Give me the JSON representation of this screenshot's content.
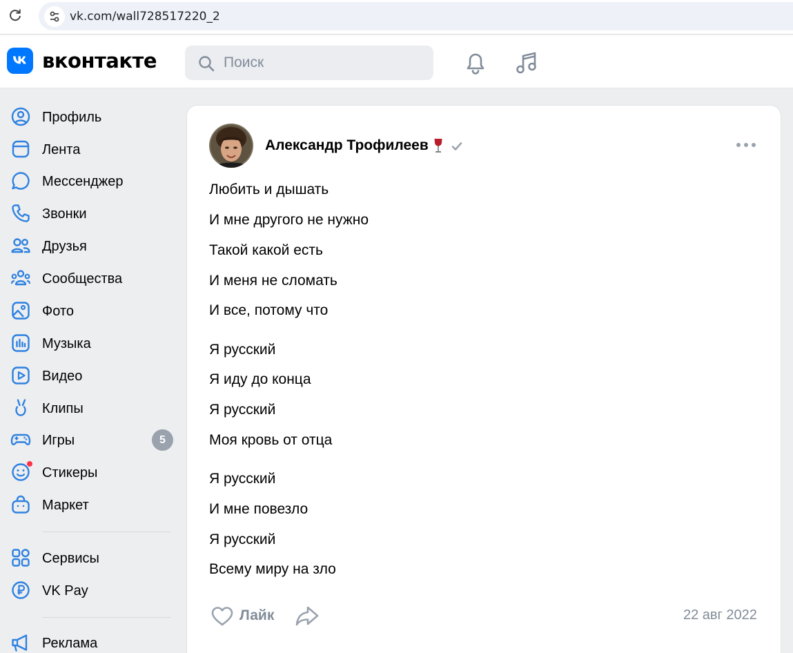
{
  "browser": {
    "url": "vk.com/wall728517220_2"
  },
  "header": {
    "brand": "вконтакте",
    "search_placeholder": "Поиск"
  },
  "sidebar": {
    "items": [
      {
        "label": "Профиль",
        "icon": "profile-icon"
      },
      {
        "label": "Лента",
        "icon": "feed-icon"
      },
      {
        "label": "Мессенджер",
        "icon": "messenger-icon"
      },
      {
        "label": "Звонки",
        "icon": "phone-icon"
      },
      {
        "label": "Друзья",
        "icon": "friends-icon"
      },
      {
        "label": "Сообщества",
        "icon": "communities-icon"
      },
      {
        "label": "Фото",
        "icon": "photo-icon"
      },
      {
        "label": "Музыка",
        "icon": "music-icon"
      },
      {
        "label": "Видео",
        "icon": "video-icon"
      },
      {
        "label": "Клипы",
        "icon": "clips-icon"
      },
      {
        "label": "Игры",
        "icon": "games-icon",
        "badge": "5"
      },
      {
        "label": "Стикеры",
        "icon": "stickers-icon"
      },
      {
        "label": "Маркет",
        "icon": "market-icon"
      },
      {
        "label": "Сервисы",
        "icon": "services-icon"
      },
      {
        "label": "VK Pay",
        "icon": "vkpay-icon"
      },
      {
        "label": "Реклама",
        "icon": "ads-icon"
      }
    ]
  },
  "post": {
    "author": "Александр Трофилеев",
    "emoji": "🍷",
    "lines": [
      "Любить и дышать",
      "И мне другого не нужно",
      "Такой какой есть",
      "И меня не сломать",
      "И все, потому что",
      "Я русский",
      "Я иду до конца",
      "Я русский",
      "Моя кровь от отца",
      "Я русский",
      "И мне повезло",
      "Я русский",
      "Всему миру на зло"
    ],
    "like_label": "Лайк",
    "date": "22 авг 2022"
  },
  "colors": {
    "accent": "#0077ff",
    "icon": "#2d81e0",
    "secondary_text": "#818c99",
    "background": "#edeef0",
    "notification_dot": "#ff3347"
  }
}
